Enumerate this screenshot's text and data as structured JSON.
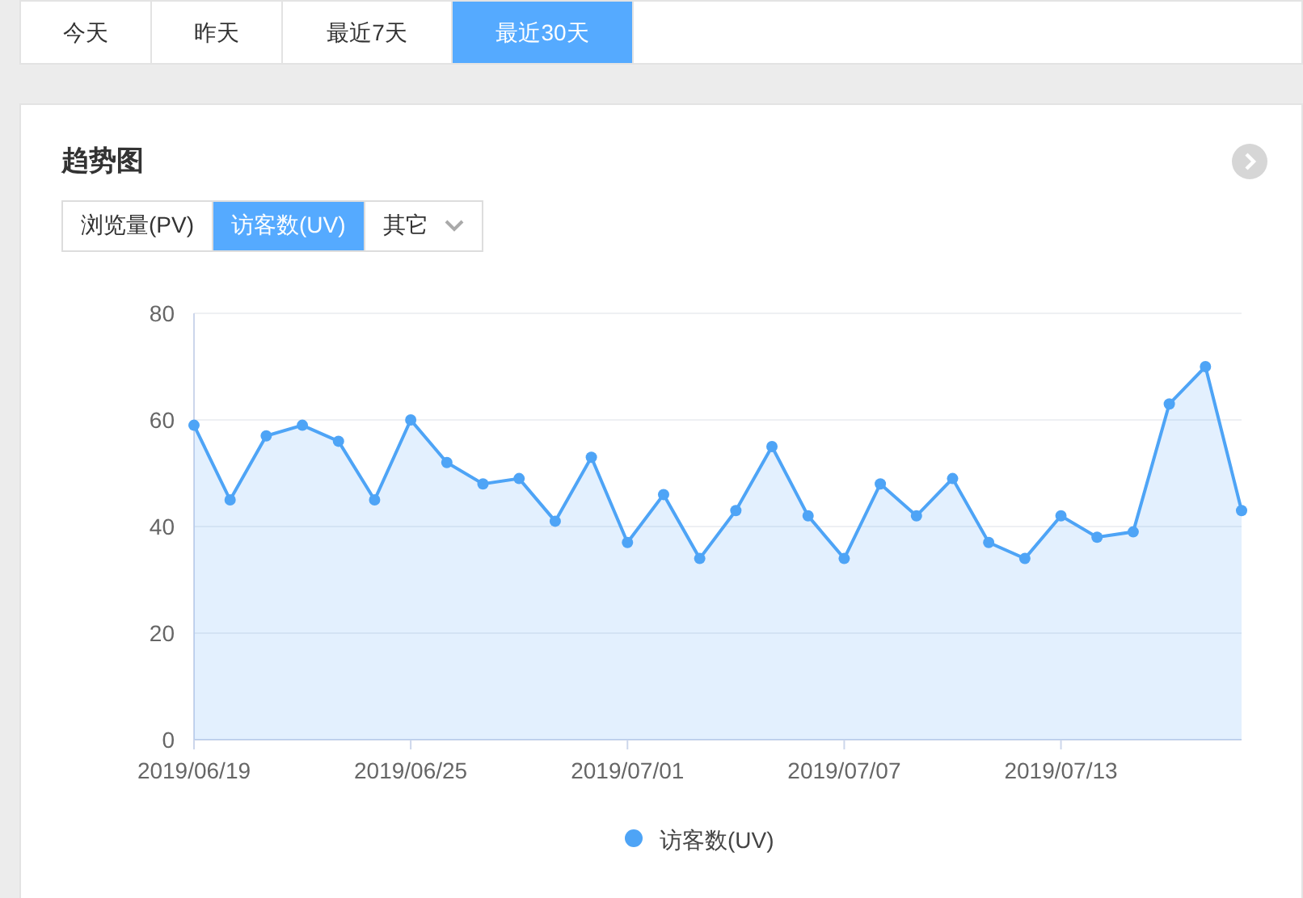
{
  "range_tabs": [
    {
      "label": "今天",
      "selected": false
    },
    {
      "label": "昨天",
      "selected": false
    },
    {
      "label": "最近7天",
      "selected": false
    },
    {
      "label": "最近30天",
      "selected": true
    }
  ],
  "card": {
    "title": "趋势图",
    "metric_tabs": [
      {
        "label": "浏览量(PV)",
        "selected": false,
        "kind": "tab"
      },
      {
        "label": "访客数(UV)",
        "selected": true,
        "kind": "tab"
      },
      {
        "label": "其它",
        "selected": false,
        "kind": "dropdown"
      }
    ],
    "chart_data": {
      "type": "area",
      "categories": [
        "2019/06/19",
        null,
        null,
        null,
        null,
        null,
        "2019/06/25",
        null,
        null,
        null,
        null,
        null,
        "2019/07/01",
        null,
        null,
        null,
        null,
        null,
        "2019/07/07",
        null,
        null,
        null,
        null,
        null,
        "2019/07/13",
        null,
        null,
        null,
        null,
        null
      ],
      "grid": true,
      "series": [
        {
          "name": "访客数(UV)",
          "color": "#4ea4f6",
          "values": [
            59,
            45,
            57,
            59,
            56,
            45,
            60,
            52,
            48,
            49,
            41,
            53,
            37,
            46,
            34,
            43,
            55,
            42,
            34,
            48,
            42,
            49,
            37,
            34,
            42,
            38,
            39,
            63,
            70,
            43
          ]
        }
      ],
      "ylim": [
        0,
        80
      ],
      "yticks": [
        0,
        20,
        40,
        60,
        80
      ]
    }
  }
}
